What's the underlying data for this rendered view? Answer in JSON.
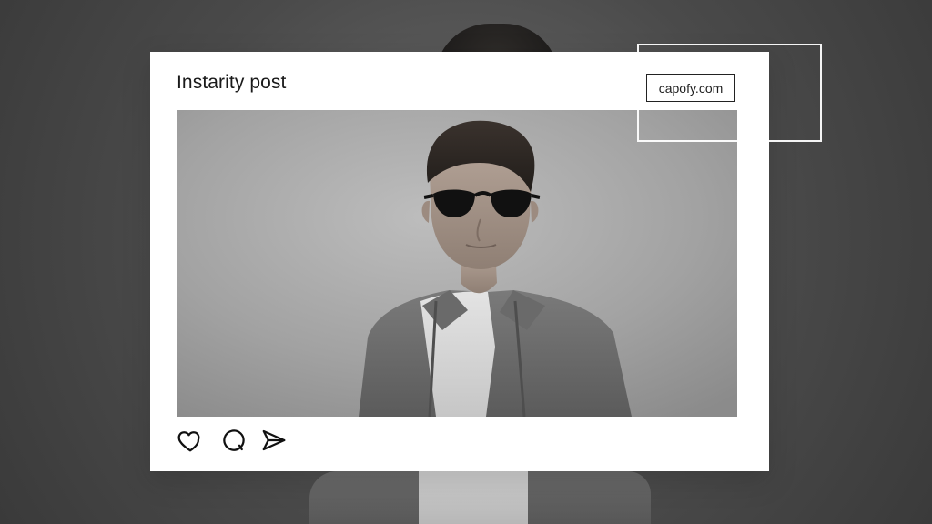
{
  "post": {
    "title": "Instarity post",
    "domain": "capofy.com"
  },
  "actions": {
    "like": "heart-icon",
    "comment": "comment-icon",
    "share": "send-icon"
  },
  "colors": {
    "card_bg": "#ffffff",
    "background": "#4a4a4a",
    "text": "#1a1a1a"
  }
}
